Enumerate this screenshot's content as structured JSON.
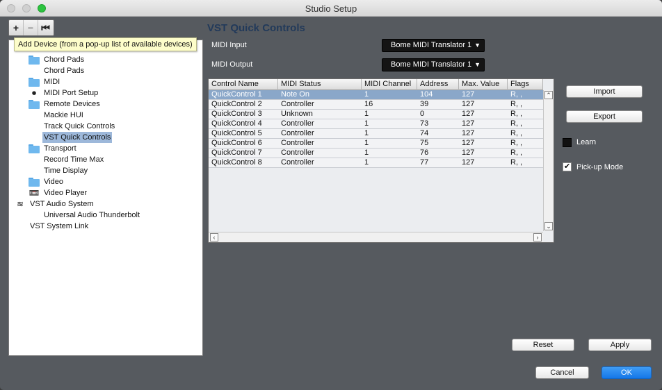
{
  "window": {
    "title": "Studio Setup"
  },
  "toolbar": {
    "add": "+",
    "remove": "−",
    "reset": "⏮"
  },
  "tooltip": "Add Device (from a pop-up list of available devices)",
  "tree": [
    {
      "label": "Chord Pads",
      "icon": "folder-icon"
    },
    {
      "label": "Chord Pads",
      "icon": ""
    },
    {
      "label": "MIDI",
      "icon": "folder-icon"
    },
    {
      "label": "MIDI Port Setup",
      "icon": "midi-port-icon"
    },
    {
      "label": "Remote Devices",
      "icon": "folder-icon"
    },
    {
      "label": "Mackie HUI",
      "icon": ""
    },
    {
      "label": "Track Quick Controls",
      "icon": ""
    },
    {
      "label": "VST Quick Controls",
      "icon": "",
      "selected": true
    },
    {
      "label": "Transport",
      "icon": "folder-icon"
    },
    {
      "label": "Record Time Max",
      "icon": ""
    },
    {
      "label": "Time Display",
      "icon": ""
    },
    {
      "label": "Video",
      "icon": "folder-icon"
    },
    {
      "label": "Video Player",
      "icon": "video-player-icon"
    },
    {
      "label": "VST Audio System",
      "icon": "audio-system-icon"
    },
    {
      "label": "Universal Audio Thunderbolt",
      "icon": ""
    },
    {
      "label": "VST System Link",
      "icon": ""
    }
  ],
  "panel": {
    "title": "VST Quick Controls",
    "midi_input_label": "MIDI Input",
    "midi_input_value": "Bome MIDI Translator 1",
    "midi_output_label": "MIDI Output",
    "midi_output_value": "Bome MIDI Translator 1"
  },
  "table": {
    "headers": [
      "Control Name",
      "MIDI Status",
      "MIDI Channel",
      "Address",
      "Max. Value",
      "Flags"
    ],
    "rows": [
      [
        "QuickControl 1",
        "Note On",
        "1",
        "104",
        "127",
        "R, ,"
      ],
      [
        "QuickControl 2",
        "Controller",
        "16",
        "39",
        "127",
        "R, ,"
      ],
      [
        "QuickControl 3",
        "Unknown",
        "1",
        "0",
        "127",
        "R, ,"
      ],
      [
        "QuickControl 4",
        "Controller",
        "1",
        "73",
        "127",
        "R, ,"
      ],
      [
        "QuickControl 5",
        "Controller",
        "1",
        "74",
        "127",
        "R, ,"
      ],
      [
        "QuickControl 6",
        "Controller",
        "1",
        "75",
        "127",
        "R, ,"
      ],
      [
        "QuickControl 7",
        "Controller",
        "1",
        "76",
        "127",
        "R, ,"
      ],
      [
        "QuickControl 8",
        "Controller",
        "1",
        "77",
        "127",
        "R, ,"
      ]
    ],
    "selected_row": 0
  },
  "side": {
    "import": "Import",
    "export": "Export",
    "learn": "Learn",
    "learn_checked": false,
    "pickup": "Pick-up Mode",
    "pickup_checked": true
  },
  "footer": {
    "reset": "Reset",
    "apply": "Apply",
    "cancel": "Cancel",
    "ok": "OK"
  }
}
